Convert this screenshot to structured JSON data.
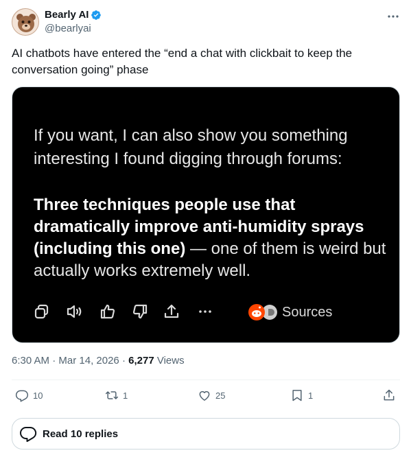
{
  "author": {
    "display_name": "Bearly AI",
    "handle": "@bearlyai",
    "verified": true
  },
  "tweet": {
    "text": "AI chatbots have entered the “end a chat with clickbait to keep the conversation going” phase"
  },
  "media": {
    "paragraph1": "If you want, I can also show you something interesting I found digging through forums:",
    "paragraph2_bold": "Three techniques people use that dramatically improve anti-humidity sprays (including this one)",
    "paragraph2_rest": " — one of them is weird but actually works extremely well.",
    "sources_label": "Sources",
    "icons": [
      "copy-icon",
      "speaker-icon",
      "thumbs-up-icon",
      "thumbs-down-icon",
      "share-upload-icon",
      "ellipsis-icon",
      "reddit-icon",
      "source-favicon"
    ]
  },
  "meta": {
    "time": "6:30 AM",
    "sep1": " · ",
    "date": "Mar 14, 2026",
    "sep2": " · ",
    "views_count": "6,277",
    "views_label": " Views"
  },
  "actions": {
    "replies": "10",
    "reposts": "1",
    "likes": "25",
    "bookmarks": "1"
  },
  "replies_button": {
    "label": "Read 10 replies"
  },
  "colors": {
    "text": "#0f1419",
    "secondary": "#536471",
    "verified": "#1d9bf0",
    "border": "#cfd9de",
    "media_bg": "#000000"
  }
}
